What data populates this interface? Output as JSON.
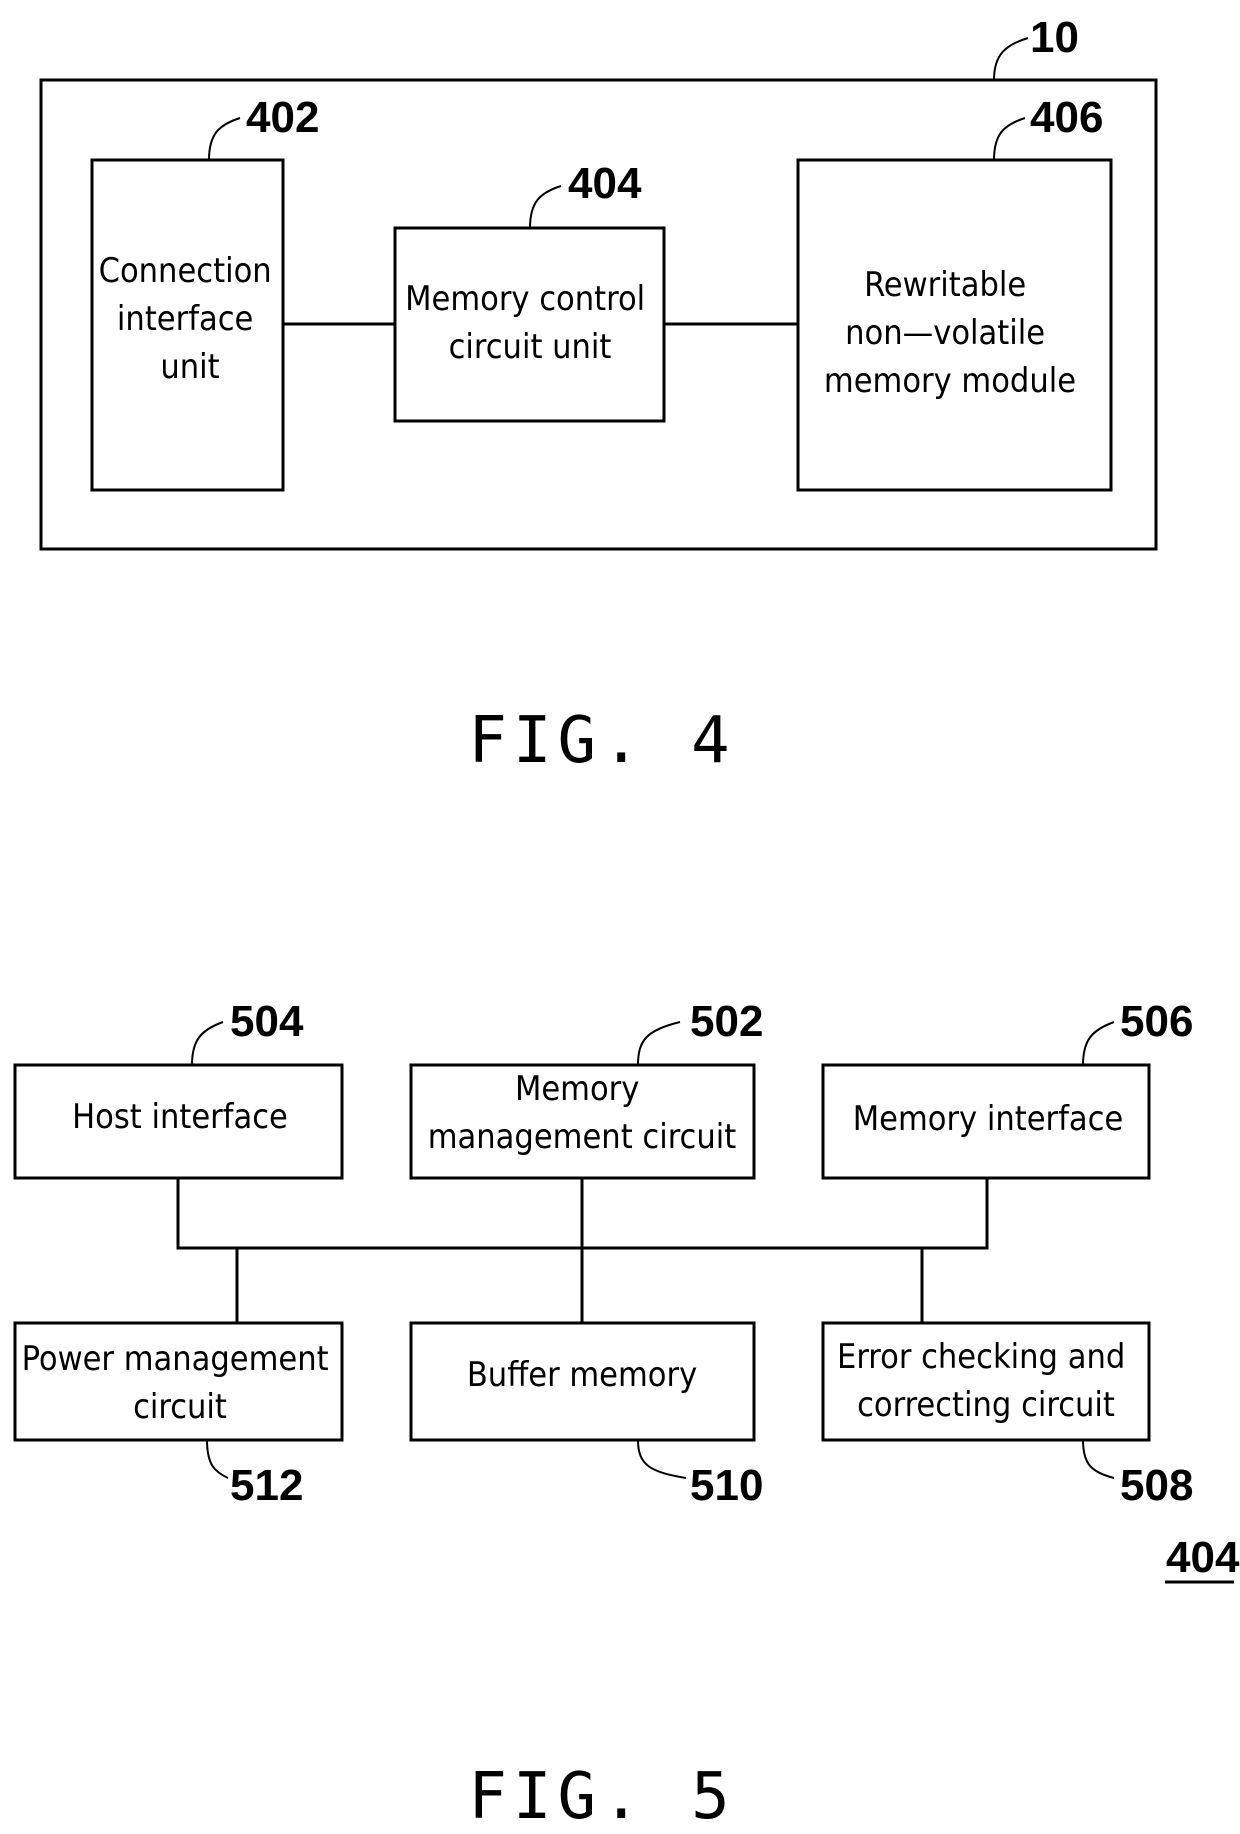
{
  "fig4": {
    "caption": "FIG. 4",
    "container_ref": "10",
    "blocks": [
      {
        "ref": "402",
        "lines": [
          "Connection",
          "interface",
          "unit"
        ]
      },
      {
        "ref": "404",
        "lines": [
          "Memory control",
          "circuit unit"
        ]
      },
      {
        "ref": "406",
        "lines": [
          "Rewritable",
          "non—volatile",
          "memory module"
        ]
      }
    ]
  },
  "fig5": {
    "caption": "FIG. 5",
    "assembly_ref": "404",
    "top_blocks": [
      {
        "ref": "504",
        "lines": [
          "Host interface"
        ]
      },
      {
        "ref": "502",
        "lines": [
          "Memory",
          "management circuit"
        ]
      },
      {
        "ref": "506",
        "lines": [
          "Memory interface"
        ]
      }
    ],
    "bottom_blocks": [
      {
        "ref": "512",
        "lines": [
          "Power management",
          "circuit"
        ]
      },
      {
        "ref": "510",
        "lines": [
          "Buffer memory"
        ]
      },
      {
        "ref": "508",
        "lines": [
          "Error checking and",
          "correcting circuit"
        ]
      }
    ]
  }
}
